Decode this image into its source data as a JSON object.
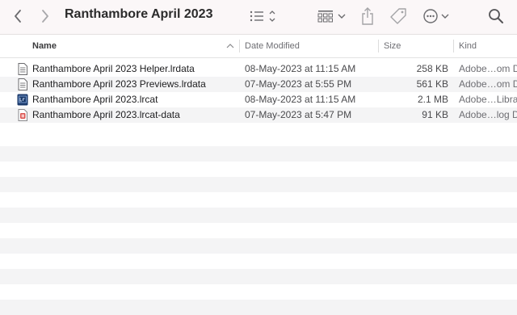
{
  "window": {
    "title": "Ranthambore April 2023"
  },
  "toolbar": {
    "icons": [
      "chevron-left-icon",
      "chevron-right-icon",
      "list-view-icon",
      "group-grid-icon",
      "share-icon",
      "tag-icon",
      "more-actions-icon",
      "search-icon"
    ]
  },
  "columns": {
    "name": "Name",
    "date_modified": "Date Modified",
    "size": "Size",
    "kind": "Kind"
  },
  "files": [
    {
      "name": "Ranthambore April 2023 Helper.lrdata",
      "date": "08-May-2023 at 11:15 AM",
      "size": "258 KB",
      "kind": "Adobe…om D",
      "icon": "document-icon"
    },
    {
      "name": "Ranthambore April 2023 Previews.lrdata",
      "date": "07-May-2023 at 5:55 PM",
      "size": "561 KB",
      "kind": "Adobe…om D",
      "icon": "document-icon"
    },
    {
      "name": "Ranthambore April 2023.lrcat",
      "date": "08-May-2023 at 11:15 AM",
      "size": "2.1 MB",
      "kind": "Adobe…Libra",
      "icon": "lightroom-catalog-icon"
    },
    {
      "name": "Ranthambore April 2023.lrcat-data",
      "date": "07-May-2023 at 5:47 PM",
      "size": "91 KB",
      "kind": "Adobe…log D",
      "icon": "lrcat-data-icon"
    }
  ],
  "colors": {
    "toolbar_bg": "#fbf7f8",
    "stripe": "#f4f4f5",
    "icon_gray": "#6b6b6e",
    "lrcat_blue": "#1b3a6b",
    "lrcat_data_red": "#d9534f"
  }
}
